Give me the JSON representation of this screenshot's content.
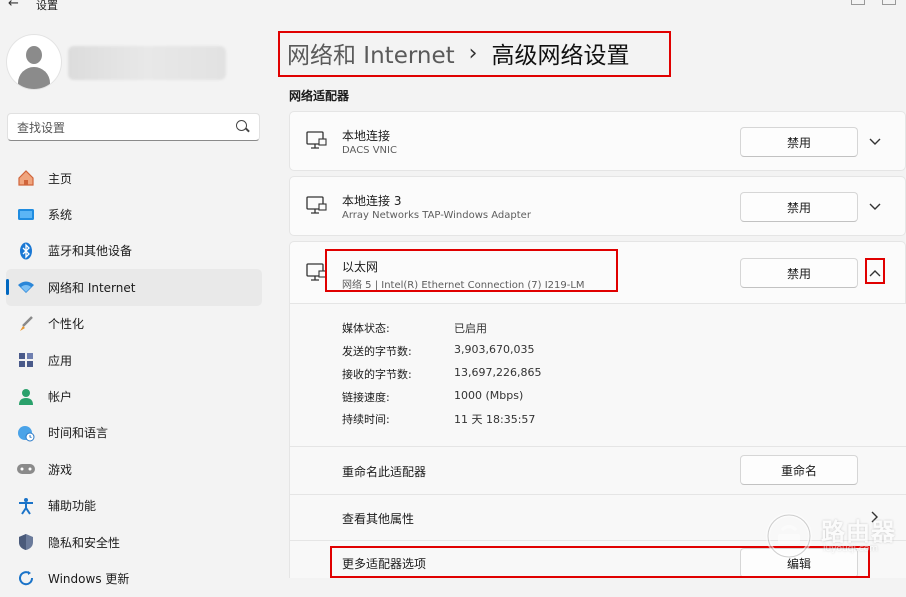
{
  "window": {
    "title": "设置"
  },
  "search": {
    "placeholder": "查找设置"
  },
  "sidebar": {
    "items": [
      {
        "label": "主页",
        "icon": "home-icon",
        "color": "#e06a3b"
      },
      {
        "label": "系统",
        "icon": "system-icon",
        "color": "#0a74c9"
      },
      {
        "label": "蓝牙和其他设备",
        "icon": "bluetooth-icon",
        "color": "#0a74c9"
      },
      {
        "label": "网络和 Internet",
        "icon": "wifi-icon",
        "color": "#0a74c9"
      },
      {
        "label": "个性化",
        "icon": "brush-icon",
        "color": "#d9892e"
      },
      {
        "label": "应用",
        "icon": "apps-icon",
        "color": "#4a5a8a"
      },
      {
        "label": "帐户",
        "icon": "account-icon",
        "color": "#2aa16b"
      },
      {
        "label": "时间和语言",
        "icon": "globe-clock-icon",
        "color": "#2a8ad8"
      },
      {
        "label": "游戏",
        "icon": "gamepad-icon",
        "color": "#777777"
      },
      {
        "label": "辅助功能",
        "icon": "accessibility-icon",
        "color": "#1a73c8"
      },
      {
        "label": "隐私和安全性",
        "icon": "shield-icon",
        "color": "#4a5a7a"
      },
      {
        "label": "Windows 更新",
        "icon": "update-icon",
        "color": "#0a74c9"
      }
    ]
  },
  "header": {
    "parent": "网络和 Internet",
    "separator": "›",
    "current": "高级网络设置"
  },
  "section": {
    "title": "网络适配器"
  },
  "adapters": [
    {
      "name": "本地连接",
      "desc": "DACS VNIC",
      "button": "禁用"
    },
    {
      "name": "本地连接 3",
      "desc": "Array Networks TAP-Windows Adapter",
      "button": "禁用"
    },
    {
      "name": "以太网",
      "desc": "网络 5 | Intel(R) Ethernet Connection (7) I219-LM",
      "button": "禁用"
    }
  ],
  "details": {
    "media_state_label": "媒体状态:",
    "media_state": "已启用",
    "sent_label": "发送的字节数:",
    "sent": "3,903,670,035",
    "received_label": "接收的字节数:",
    "received": "13,697,226,865",
    "speed_label": "链接速度:",
    "speed": "1000 (Mbps)",
    "duration_label": "持续时间:",
    "duration": "11 天 18:35:57"
  },
  "actions": {
    "rename_label": "重命名此适配器",
    "rename_button": "重命名",
    "more_props_label": "查看其他属性",
    "more_options_label": "更多适配器选项",
    "edit_button": "编辑"
  },
  "watermark": {
    "text": "路由器",
    "sub": "luyouqi.com"
  },
  "colors": {
    "accent": "#0067c0",
    "highlight": "#e00000"
  }
}
